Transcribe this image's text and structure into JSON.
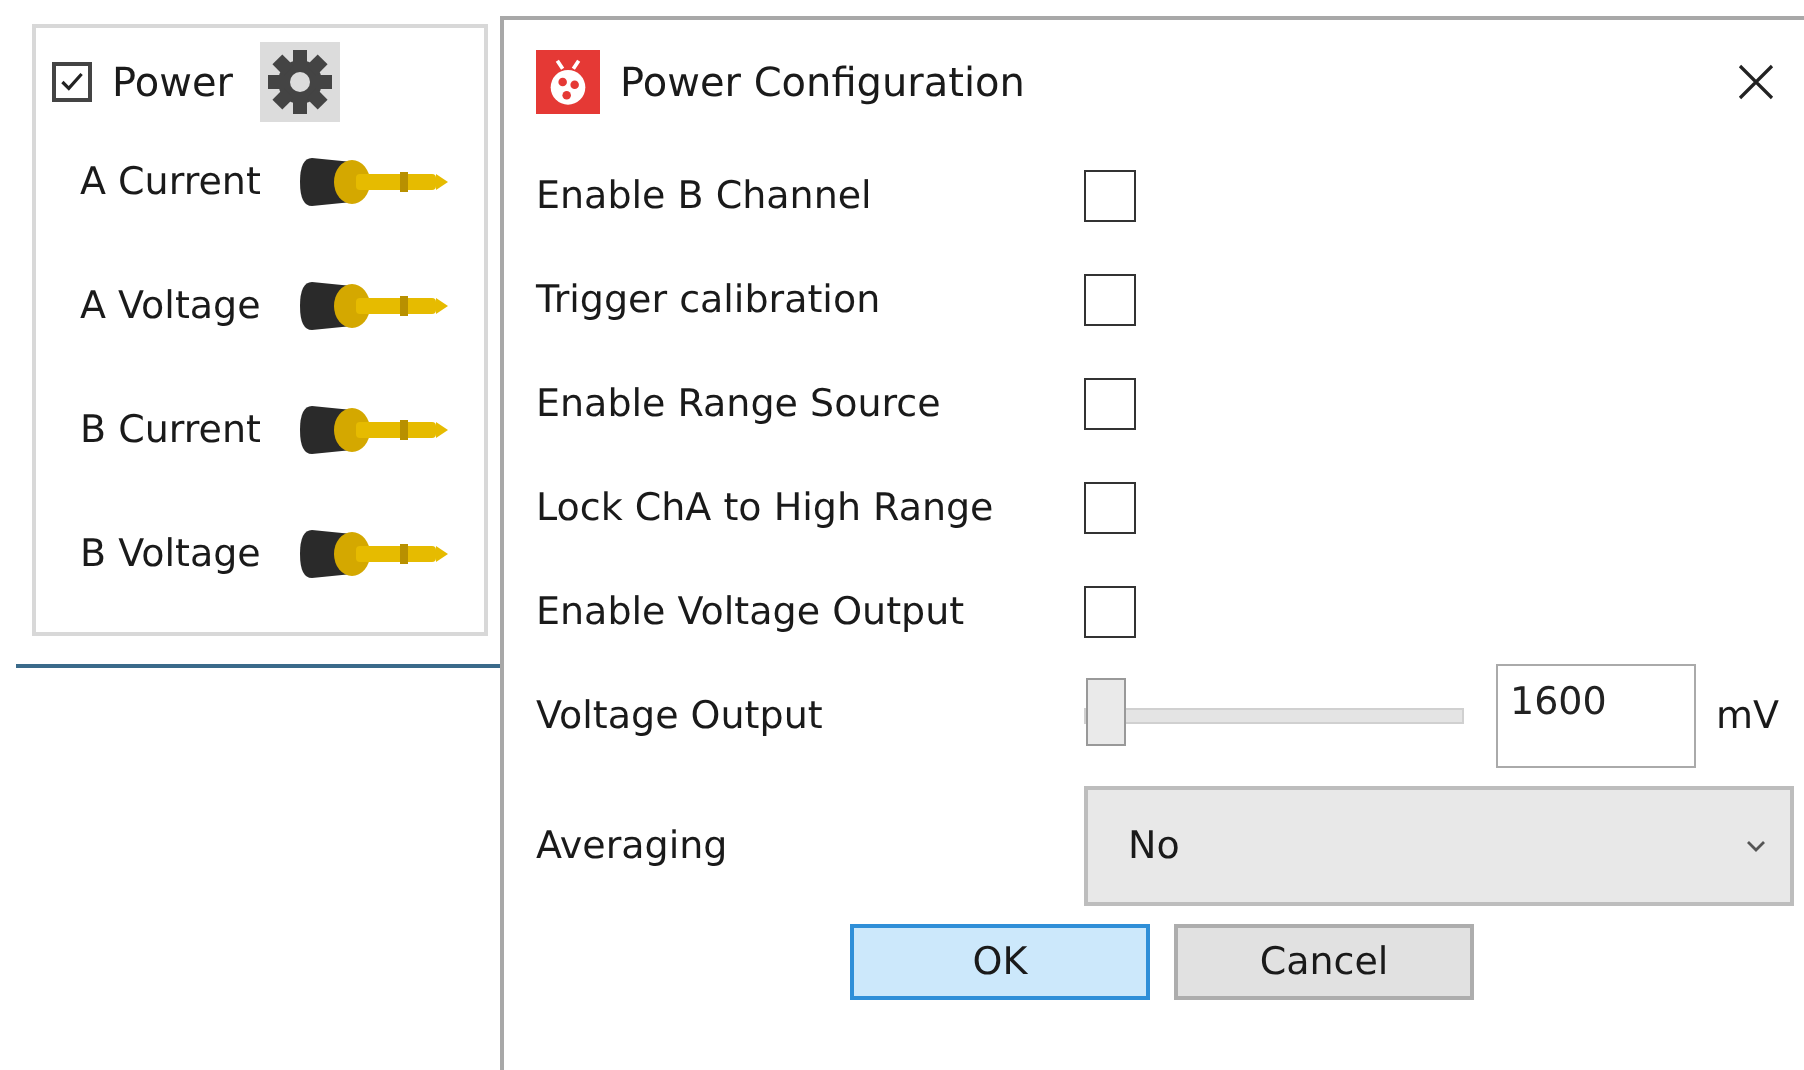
{
  "panel": {
    "power": {
      "label": "Power",
      "checked": true
    },
    "channels": [
      {
        "label": "A Current"
      },
      {
        "label": "A Voltage"
      },
      {
        "label": "B Current"
      },
      {
        "label": "B Voltage"
      }
    ]
  },
  "dialog": {
    "title": "Power Configuration",
    "options": [
      {
        "kind": "checkbox",
        "label": "Enable B Channel",
        "checked": false
      },
      {
        "kind": "checkbox",
        "label": "Trigger calibration",
        "checked": false
      },
      {
        "kind": "checkbox",
        "label": "Enable Range Source",
        "checked": false
      },
      {
        "kind": "checkbox",
        "label": "Lock ChA to High Range",
        "checked": false
      },
      {
        "kind": "checkbox",
        "label": "Enable Voltage Output",
        "checked": false
      },
      {
        "kind": "slider",
        "label": "Voltage Output",
        "level": 0,
        "value": "1600",
        "unit": "mV"
      },
      {
        "kind": "dropdown",
        "label": "Averaging",
        "value": "No"
      }
    ],
    "buttons": [
      {
        "label": "OK",
        "default": true
      },
      {
        "label": "Cancel",
        "default": false
      }
    ]
  }
}
